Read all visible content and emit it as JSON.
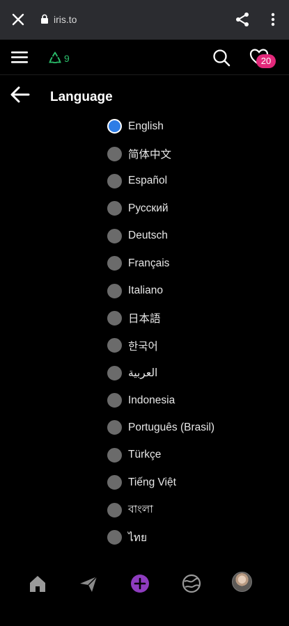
{
  "browser": {
    "url": "iris.to"
  },
  "header": {
    "relay_count": "9",
    "notification_count": "20"
  },
  "page": {
    "title": "Language"
  },
  "languages": [
    {
      "label": "English",
      "selected": true
    },
    {
      "label": "简体中文",
      "selected": false
    },
    {
      "label": "Español",
      "selected": false
    },
    {
      "label": "Русский",
      "selected": false
    },
    {
      "label": "Deutsch",
      "selected": false
    },
    {
      "label": "Français",
      "selected": false
    },
    {
      "label": "Italiano",
      "selected": false
    },
    {
      "label": "日本語",
      "selected": false
    },
    {
      "label": "한국어",
      "selected": false
    },
    {
      "label": "العربية",
      "selected": false
    },
    {
      "label": "Indonesia",
      "selected": false
    },
    {
      "label": "Português (Brasil)",
      "selected": false
    },
    {
      "label": "Türkçe",
      "selected": false
    },
    {
      "label": "Tiếng Việt",
      "selected": false
    },
    {
      "label": "বাংলা",
      "selected": false
    },
    {
      "label": "ไทย",
      "selected": false
    }
  ],
  "icons": {
    "close": "close-icon",
    "lock": "lock-icon",
    "share": "share-icon",
    "more": "kebab-icon",
    "menu": "hamburger-icon",
    "relay": "relay-icon",
    "search": "search-icon",
    "notifications": "heart-icon",
    "back": "back-arrow-icon",
    "home": "home-icon",
    "messages": "paper-plane-icon",
    "new_post": "plus-circle-icon",
    "explore": "globe-icon"
  },
  "colors": {
    "background": "#000000",
    "browser_bar": "#2b2c30",
    "accent_badge": "#e3287a",
    "relay_green": "#2bbf6c",
    "radio_selected": "#2e7de6",
    "radio_unselected": "#6b6b6b",
    "new_post_purple": "#8e3cbf"
  }
}
